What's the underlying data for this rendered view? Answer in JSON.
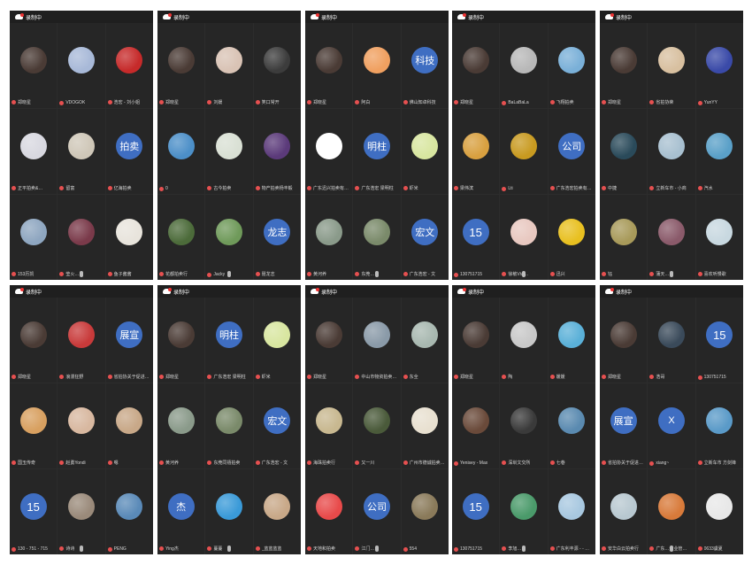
{
  "recording_label": "录制中",
  "phones": [
    {
      "cells": [
        {
          "name": "郑晓星",
          "avatar": "photo",
          "color": "#4a3b35"
        },
        {
          "name": "VDOGOK",
          "avatar": "photo",
          "color": "#a8b9d8"
        },
        {
          "name": "浩宏 - 刘小姐",
          "avatar": "photo",
          "color": "#c62a2a"
        },
        {
          "name": "正平拍卖&amp;…",
          "avatar": "photo",
          "color": "#d8d8e0"
        },
        {
          "name": "留富",
          "avatar": "photo",
          "color": "#cfc7b8"
        },
        {
          "name": "亿海拍卖",
          "avatar": "text",
          "text": "拍卖"
        },
        {
          "name": "153历凯",
          "avatar": "photo",
          "color": "#8ea6c0"
        },
        {
          "name": "莹火…",
          "avatar": "photo",
          "color": "#7a3a4a"
        },
        {
          "name": "鱼子酱酱",
          "avatar": "photo",
          "color": "#e8e4dc"
        }
      ]
    },
    {
      "cells": [
        {
          "name": "郑晓星",
          "avatar": "photo",
          "color": "#4a3b35"
        },
        {
          "name": "刘媛",
          "avatar": "photo",
          "color": "#d9c3b5"
        },
        {
          "name": "笑口常开",
          "avatar": "photo",
          "color": "#3c3c3c"
        },
        {
          "name": "0",
          "avatar": "photo",
          "color": "#4c8fc8"
        },
        {
          "name": "古今拍卖",
          "avatar": "photo",
          "color": "#d9e0d4"
        },
        {
          "name": "物产拍卖杨丰毅",
          "avatar": "photo",
          "color": "#5b3a7a"
        },
        {
          "name": "花都拍卖行",
          "avatar": "photo",
          "color": "#4c6b3a"
        },
        {
          "name": "Jacky",
          "avatar": "photo",
          "color": "#6f9a5a"
        },
        {
          "name": "聂龙志",
          "avatar": "text",
          "text": "龙志"
        }
      ]
    },
    {
      "cells": [
        {
          "name": "郑晓星",
          "avatar": "photo",
          "color": "#4a3b35"
        },
        {
          "name": "阿白",
          "avatar": "photo",
          "color": "#f0a060"
        },
        {
          "name": "佛山知卓科技",
          "avatar": "text",
          "text": "科技"
        },
        {
          "name": "广东迅兴拍卖有…",
          "avatar": "photo",
          "color": "#ffffff"
        },
        {
          "name": "广东浩宏 梁明柱",
          "avatar": "text",
          "text": "明柱"
        },
        {
          "name": "虾米",
          "avatar": "photo",
          "color": "#d8e6a0"
        },
        {
          "name": "黄河养",
          "avatar": "photo",
          "color": "#8a9a8a"
        },
        {
          "name": "东莞…",
          "avatar": "photo",
          "color": "#7a8a6a"
        },
        {
          "name": "广东浩宏 - 文",
          "avatar": "text",
          "text": "宏文"
        }
      ]
    },
    {
      "cells": [
        {
          "name": "郑晓星",
          "avatar": "photo",
          "color": "#4a3b35"
        },
        {
          "name": "BaLaBaLa",
          "avatar": "photo",
          "color": "#b8b8b8"
        },
        {
          "name": "飞翔拍卖",
          "avatar": "photo",
          "color": "#7ab0d8"
        },
        {
          "name": "梁伟滨",
          "avatar": "photo",
          "color": "#d8a040"
        },
        {
          "name": "Lti",
          "avatar": "photo",
          "color": "#c89a20"
        },
        {
          "name": "广东浩宏拍卖有…",
          "avatar": "text",
          "text": "公司"
        },
        {
          "name": "130751715",
          "avatar": "num",
          "text": "15"
        },
        {
          "name": "徐敏Vivi…",
          "avatar": "photo",
          "color": "#e8c8c0"
        },
        {
          "name": "迅兴",
          "avatar": "photo",
          "color": "#e8c020"
        }
      ]
    },
    {
      "cells": [
        {
          "name": "郑晓星",
          "avatar": "photo",
          "color": "#4a3b35"
        },
        {
          "name": "省拍协荣",
          "avatar": "photo",
          "color": "#d8c0a0"
        },
        {
          "name": "YunYY",
          "avatar": "photo",
          "color": "#3a4aa8"
        },
        {
          "name": "中捷",
          "avatar": "photo",
          "color": "#2a4a5a"
        },
        {
          "name": "立新车市 - 小商",
          "avatar": "photo",
          "color": "#a8c0d0"
        },
        {
          "name": "汽水",
          "avatar": "photo",
          "color": "#5aa0c8"
        },
        {
          "name": "钰",
          "avatar": "photo",
          "color": "#a89a5a"
        },
        {
          "name": "蒲天…",
          "avatar": "photo",
          "color": "#8a5a6a"
        },
        {
          "name": "喜欢听慢歌",
          "avatar": "photo",
          "color": "#c8d8e0"
        }
      ]
    },
    {
      "cells": [
        {
          "name": "郑晓星",
          "avatar": "photo",
          "color": "#4a3b35"
        },
        {
          "name": "浪漫狂野",
          "avatar": "photo",
          "color": "#c83a3a"
        },
        {
          "name": "省拍协关于促进…",
          "avatar": "text",
          "text": "展宣"
        },
        {
          "name": "国玉传奇",
          "avatar": "photo",
          "color": "#d8a060"
        },
        {
          "name": "赵勇Yondi",
          "avatar": "photo",
          "color": "#d8b8a0"
        },
        {
          "name": "嗯",
          "avatar": "photo",
          "color": "#c8a888"
        },
        {
          "name": "130 - 751 - 715",
          "avatar": "num",
          "text": "15"
        },
        {
          "name": "诗诗",
          "avatar": "photo",
          "color": "#9a8a7a"
        },
        {
          "name": "PENG",
          "avatar": "photo",
          "color": "#5a8ab8"
        }
      ]
    },
    {
      "cells": [
        {
          "name": "郑晓星",
          "avatar": "photo",
          "color": "#4a3b35"
        },
        {
          "name": "广东浩宏 梁明柱",
          "avatar": "text",
          "text": "明柱"
        },
        {
          "name": "虾米",
          "avatar": "photo",
          "color": "#d8e6a0"
        },
        {
          "name": "黄河养",
          "avatar": "photo",
          "color": "#8a9a8a"
        },
        {
          "name": "东莞同禧拍卖",
          "avatar": "photo",
          "color": "#7a8a6a"
        },
        {
          "name": "广东浩宏 - 文",
          "avatar": "text",
          "text": "宏文"
        },
        {
          "name": "Ying杰",
          "avatar": "text",
          "text": "杰"
        },
        {
          "name": "蔓蔓",
          "avatar": "photo",
          "color": "#3a9ad8"
        },
        {
          "name": "_蓝蓝蓝蓝",
          "avatar": "photo",
          "color": "#c8a888"
        }
      ]
    },
    {
      "cells": [
        {
          "name": "郑晓星",
          "avatar": "photo",
          "color": "#4a3b35"
        },
        {
          "name": "中山市物资拍卖…",
          "avatar": "photo",
          "color": "#8a9aa8"
        },
        {
          "name": "东全",
          "avatar": "photo",
          "color": "#a8b8b0"
        },
        {
          "name": "海珠拍卖行",
          "avatar": "photo",
          "color": "#c8b890"
        },
        {
          "name": "又一川",
          "avatar": "photo",
          "color": "#4a5a3a"
        },
        {
          "name": "广州市德诚拍卖…",
          "avatar": "photo",
          "color": "#e8e0d0"
        },
        {
          "name": "天地和拍卖",
          "avatar": "photo",
          "color": "#e84a4a"
        },
        {
          "name": "江门…",
          "avatar": "text",
          "text": "公司"
        },
        {
          "name": "554",
          "avatar": "photo",
          "color": "#8a7a5a"
        }
      ]
    },
    {
      "cells": [
        {
          "name": "郑晓星",
          "avatar": "photo",
          "color": "#4a3b35"
        },
        {
          "name": "陶",
          "avatar": "photo",
          "color": "#c8c8c8"
        },
        {
          "name": "媛媛",
          "avatar": "photo",
          "color": "#5ab0d8"
        },
        {
          "name": "Yenisey - Max",
          "avatar": "photo",
          "color": "#6a4a3a"
        },
        {
          "name": "深圳文交所",
          "avatar": "photo",
          "color": "#3a3a3a"
        },
        {
          "name": "七巷",
          "avatar": "photo",
          "color": "#5a8ab0"
        },
        {
          "name": "130751715",
          "avatar": "num",
          "text": "15"
        },
        {
          "name": "李旭…",
          "avatar": "photo",
          "color": "#4a9a6a"
        },
        {
          "name": "广东利丰源 - - 刘敏",
          "avatar": "photo",
          "color": "#a8c8e0"
        }
      ]
    },
    {
      "cells": [
        {
          "name": "郑晓星",
          "avatar": "photo",
          "color": "#4a3b35"
        },
        {
          "name": "浩哥",
          "avatar": "photo",
          "color": "#3a4a5a"
        },
        {
          "name": "130751715",
          "avatar": "num",
          "text": "15"
        },
        {
          "name": "省拍协关于促进…",
          "avatar": "text",
          "text": "展宣"
        },
        {
          "name": "xiang~",
          "avatar": "text",
          "text": "X"
        },
        {
          "name": "立新车市 方剑锋",
          "avatar": "photo",
          "color": "#5a9ac8"
        },
        {
          "name": "安华白云拍卖行",
          "avatar": "photo",
          "color": "#b8c8d0"
        },
        {
          "name": "广东…企业管…",
          "avatar": "photo",
          "color": "#d87a3a"
        },
        {
          "name": "0633虞夏",
          "avatar": "photo",
          "color": "#e8e8e8"
        }
      ]
    }
  ]
}
